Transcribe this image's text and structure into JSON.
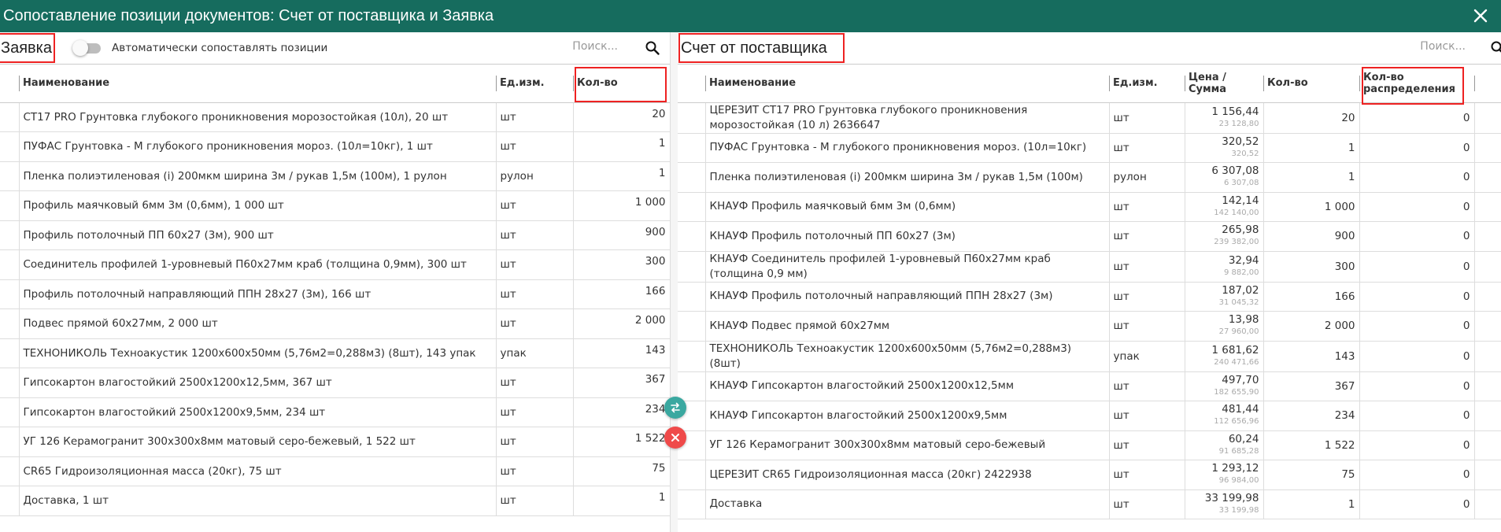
{
  "window": {
    "title": "Сопоставление позиции документов: Счет от поставщика и Заявка"
  },
  "left": {
    "title": "Заявка",
    "auto_match_label": "Автоматически сопоставлять позиции",
    "search_placeholder": "Поиск...",
    "columns": {
      "name": "Наименование",
      "unit": "Ед.изм.",
      "qty": "Кол-во"
    },
    "rows": [
      {
        "name": "CT17 PRO Грунтовка глубокого проникновения морозостойкая (10л), 20 шт",
        "unit": "шт",
        "qty": "20"
      },
      {
        "name": "ПУФАС Грунтовка - М глубокого проникновения мороз. (10л=10кг), 1 шт",
        "unit": "шт",
        "qty": "1"
      },
      {
        "name": "Пленка полиэтиленовая (i) 200мкм ширина 3м / рукав 1,5м (100м), 1 рулон",
        "unit": "рулон",
        "qty": "1"
      },
      {
        "name": "Профиль маячковый 6мм 3м (0,6мм), 1 000 шт",
        "unit": "шт",
        "qty": "1 000"
      },
      {
        "name": "Профиль потолочный ПП 60x27 (3м), 900 шт",
        "unit": "шт",
        "qty": "900"
      },
      {
        "name": "Соединитель профилей 1-уровневый П60х27мм краб (толщина 0,9мм), 300 шт",
        "unit": "шт",
        "qty": "300"
      },
      {
        "name": "Профиль потолочный направляющий ППН 28x27 (3м), 166 шт",
        "unit": "шт",
        "qty": "166"
      },
      {
        "name": "Подвес прямой 60х27мм, 2 000 шт",
        "unit": "шт",
        "qty": "2 000"
      },
      {
        "name": "ТЕХНОНИКОЛЬ Техноакустик 1200х600х50мм (5,76м2=0,288м3) (8шт), 143 упак",
        "unit": "упак",
        "qty": "143"
      },
      {
        "name": "Гипсокартон влагостойкий 2500х1200х12,5мм, 367 шт",
        "unit": "шт",
        "qty": "367"
      },
      {
        "name": "Гипсокартон влагостойкий 2500х1200х9,5мм, 234 шт",
        "unit": "шт",
        "qty": "234"
      },
      {
        "name": "УГ 126 Керамогранит 300х300х8мм матовый серо-бежевый, 1 522 шт",
        "unit": "шт",
        "qty": "1 522"
      },
      {
        "name": "CR65 Гидроизоляционная масса (20кг), 75 шт",
        "unit": "шт",
        "qty": "75"
      },
      {
        "name": "Доставка, 1 шт",
        "unit": "шт",
        "qty": "1"
      }
    ]
  },
  "right": {
    "title": "Счет от поставщика",
    "search_placeholder": "Поиск...",
    "columns": {
      "name": "Наименование",
      "unit": "Ед.изм.",
      "price": "Цена / Сумма",
      "qty": "Кол-во",
      "dist": "Кол-во распределения"
    },
    "rows": [
      {
        "name": "ЦЕРЕЗИТ CT17 PRO Грунтовка глубокого проникновения морозостойкая (10 л) 2636647",
        "unit": "шт",
        "price": "1 156,44",
        "sum": "23 128,80",
        "qty": "20",
        "dist": "0"
      },
      {
        "name": "ПУФАС Грунтовка - М глубокого проникновения мороз. (10л=10кг)",
        "unit": "шт",
        "price": "320,52",
        "sum": "320,52",
        "qty": "1",
        "dist": "0"
      },
      {
        "name": "Пленка полиэтиленовая (i) 200мкм ширина 3м / рукав 1,5м (100м)",
        "unit": "рулон",
        "price": "6 307,08",
        "sum": "6 307,08",
        "qty": "1",
        "dist": "0"
      },
      {
        "name": "КНАУФ Профиль маячковый 6мм 3м (0,6мм)",
        "unit": "шт",
        "price": "142,14",
        "sum": "142 140,00",
        "qty": "1 000",
        "dist": "0"
      },
      {
        "name": "КНАУФ Профиль потолочный ПП 60x27 (3м)",
        "unit": "шт",
        "price": "265,98",
        "sum": "239 382,00",
        "qty": "900",
        "dist": "0"
      },
      {
        "name": "КНАУФ Соединитель профилей 1-уровневый П60х27мм краб (толщина 0,9 мм)",
        "unit": "шт",
        "price": "32,94",
        "sum": "9 882,00",
        "qty": "300",
        "dist": "0"
      },
      {
        "name": "КНАУФ Профиль потолочный направляющий ППН 28x27 (3м)",
        "unit": "шт",
        "price": "187,02",
        "sum": "31 045,32",
        "qty": "166",
        "dist": "0"
      },
      {
        "name": "КНАУФ Подвес прямой 60х27мм",
        "unit": "шт",
        "price": "13,98",
        "sum": "27 960,00",
        "qty": "2 000",
        "dist": "0"
      },
      {
        "name": "ТЕХНОНИКОЛЬ Техноакустик 1200х600х50мм (5,76м2=0,288м3) (8шт)",
        "unit": "упак",
        "price": "1 681,62",
        "sum": "240 471,66",
        "qty": "143",
        "dist": "0"
      },
      {
        "name": "КНАУФ Гипсокартон влагостойкий 2500х1200х12,5мм",
        "unit": "шт",
        "price": "497,70",
        "sum": "182 655,90",
        "qty": "367",
        "dist": "0"
      },
      {
        "name": "КНАУФ Гипсокартон влагостойкий 2500х1200х9,5мм",
        "unit": "шт",
        "price": "481,44",
        "sum": "112 656,96",
        "qty": "234",
        "dist": "0"
      },
      {
        "name": "УГ 126 Керамогранит 300х300х8мм матовый серо-бежевый",
        "unit": "шт",
        "price": "60,24",
        "sum": "91 685,28",
        "qty": "1 522",
        "dist": "0"
      },
      {
        "name": "ЦЕРЕЗИТ CR65 Гидроизоляционная масса (20кг) 2422938",
        "unit": "шт",
        "price": "1 293,12",
        "sum": "96 984,00",
        "qty": "75",
        "dist": "0"
      },
      {
        "name": "Доставка",
        "unit": "шт",
        "price": "33 199,98",
        "sum": "33 199,98",
        "qty": "1",
        "dist": "0"
      }
    ]
  },
  "colors": {
    "titlebar": "#166c5e",
    "highlight": "#e22222",
    "swap_button": "#3aa8a0",
    "cancel_button": "#ef4a4a"
  },
  "icons": {
    "close": "close-icon",
    "search": "search-icon",
    "swap": "swap-icon",
    "cancel": "close-icon"
  }
}
